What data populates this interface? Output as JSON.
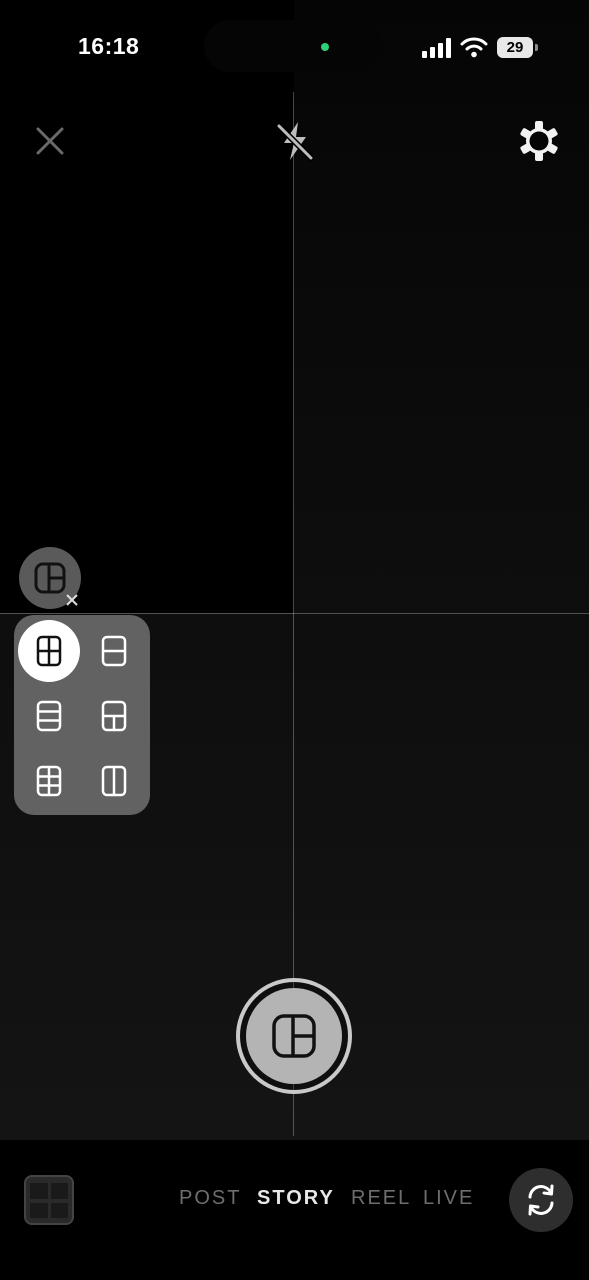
{
  "status_bar": {
    "time": "16:18",
    "battery": "29",
    "icons": [
      "signal-icon",
      "wifi-icon",
      "battery-icon"
    ],
    "recording_indicator_color": "#2fd07a"
  },
  "top_controls": {
    "icons": [
      "close-icon",
      "flash-off-icon",
      "settings-gear-icon"
    ]
  },
  "layout_picker": {
    "toggle_icon": "layout-icon",
    "options": [
      {
        "icon": "grid-2x2-icon",
        "selected": true
      },
      {
        "icon": "split-horizontal-2-icon",
        "selected": false
      },
      {
        "icon": "split-horizontal-3-icon",
        "selected": false
      },
      {
        "icon": "top-one-bottom-two-icon",
        "selected": false
      },
      {
        "icon": "grid-2x3-icon",
        "selected": false
      },
      {
        "icon": "split-vertical-2-icon",
        "selected": false
      }
    ]
  },
  "shutter": {
    "icon": "layout-icon"
  },
  "modes": [
    {
      "label": "POST",
      "active": false
    },
    {
      "label": "STORY",
      "active": true
    },
    {
      "label": "REEL",
      "active": false
    },
    {
      "label": "LIVE",
      "active": false
    }
  ],
  "bottom_icons": [
    "gallery-thumbnail-icon",
    "flip-camera-icon"
  ]
}
